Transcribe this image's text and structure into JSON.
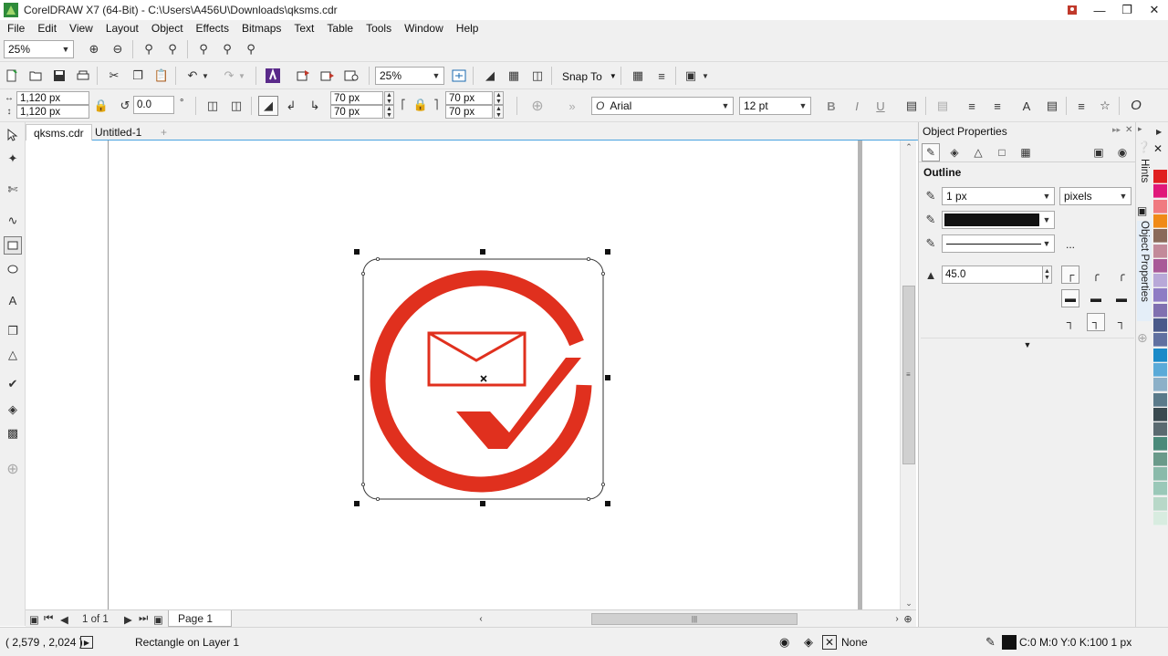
{
  "window": {
    "title": "CorelDRAW X7 (64-Bit) - C:\\Users\\A456U\\Downloads\\qksms.cdr"
  },
  "menu": [
    "File",
    "Edit",
    "View",
    "Layout",
    "Object",
    "Effects",
    "Bitmaps",
    "Text",
    "Table",
    "Tools",
    "Window",
    "Help"
  ],
  "toolbar1": {
    "zoom_value": "25%"
  },
  "toolbar2": {
    "zoom_value": "25%",
    "snap_to_label": "Snap To"
  },
  "propbar": {
    "width": "1,120 px",
    "height": "1,120 px",
    "rotation": "0.0",
    "degree": "°",
    "corner_tl": "70 px",
    "corner_bl": "70 px",
    "corner_tr": "70 px",
    "corner_br": "70 px",
    "font_name": "Arial",
    "font_size": "12 pt"
  },
  "doc_tabs": [
    {
      "label": "qksms.cdr",
      "active": true
    },
    {
      "label": "Untitled-1",
      "active": false
    }
  ],
  "page_nav": {
    "page_count": "1 of 1",
    "page_tab": "Page 1"
  },
  "status": {
    "coords": "( 2,579 , 2,024 )",
    "object_info": "Rectangle on Layer 1",
    "fill_label": "None",
    "outline_info": "C:0 M:0 Y:0 K:100  1 px"
  },
  "docker": {
    "title": "Object Properties",
    "section": "Outline",
    "outline_width": "1 px",
    "units": "pixels",
    "miter_limit": "45.0",
    "more": "...",
    "outline_color": "#111111"
  },
  "side_tabs": {
    "hints": "Hints",
    "object_properties": "Object Properties"
  },
  "artwork": {
    "logo_color": "#e0301e"
  },
  "palette_colors": [
    "#e02020",
    "#e0187a",
    "#f07a80",
    "#f08a18",
    "#8a6a5a",
    "#c28a9a",
    "#a85a98",
    "#b8a8d8",
    "#8e7cc4",
    "#8070b0",
    "#4a5a8a",
    "#6070a0",
    "#1a8ac8",
    "#5aaad8",
    "#8cb0c8",
    "#5a7a8a",
    "#3a4a50",
    "#5a6a70",
    "#4a8a7a",
    "#6a9a8a",
    "#8abaaa",
    "#9ac8b8",
    "#b8d8c8",
    "#d8ece0"
  ]
}
